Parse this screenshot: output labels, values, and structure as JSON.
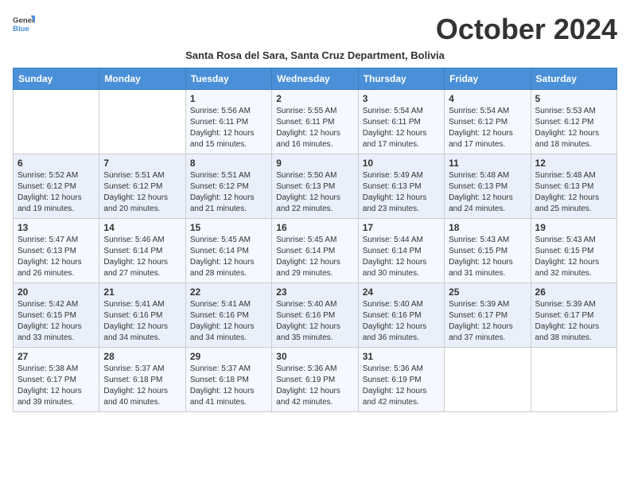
{
  "logo": {
    "text_general": "General",
    "text_blue": "Blue"
  },
  "header": {
    "month_title": "October 2024",
    "subtitle": "Santa Rosa del Sara, Santa Cruz Department, Bolivia"
  },
  "weekdays": [
    "Sunday",
    "Monday",
    "Tuesday",
    "Wednesday",
    "Thursday",
    "Friday",
    "Saturday"
  ],
  "weeks": [
    [
      {
        "day": "",
        "sunrise": "",
        "sunset": "",
        "daylight": ""
      },
      {
        "day": "",
        "sunrise": "",
        "sunset": "",
        "daylight": ""
      },
      {
        "day": "1",
        "sunrise": "Sunrise: 5:56 AM",
        "sunset": "Sunset: 6:11 PM",
        "daylight": "Daylight: 12 hours and 15 minutes."
      },
      {
        "day": "2",
        "sunrise": "Sunrise: 5:55 AM",
        "sunset": "Sunset: 6:11 PM",
        "daylight": "Daylight: 12 hours and 16 minutes."
      },
      {
        "day": "3",
        "sunrise": "Sunrise: 5:54 AM",
        "sunset": "Sunset: 6:11 PM",
        "daylight": "Daylight: 12 hours and 17 minutes."
      },
      {
        "day": "4",
        "sunrise": "Sunrise: 5:54 AM",
        "sunset": "Sunset: 6:12 PM",
        "daylight": "Daylight: 12 hours and 17 minutes."
      },
      {
        "day": "5",
        "sunrise": "Sunrise: 5:53 AM",
        "sunset": "Sunset: 6:12 PM",
        "daylight": "Daylight: 12 hours and 18 minutes."
      }
    ],
    [
      {
        "day": "6",
        "sunrise": "Sunrise: 5:52 AM",
        "sunset": "Sunset: 6:12 PM",
        "daylight": "Daylight: 12 hours and 19 minutes."
      },
      {
        "day": "7",
        "sunrise": "Sunrise: 5:51 AM",
        "sunset": "Sunset: 6:12 PM",
        "daylight": "Daylight: 12 hours and 20 minutes."
      },
      {
        "day": "8",
        "sunrise": "Sunrise: 5:51 AM",
        "sunset": "Sunset: 6:12 PM",
        "daylight": "Daylight: 12 hours and 21 minutes."
      },
      {
        "day": "9",
        "sunrise": "Sunrise: 5:50 AM",
        "sunset": "Sunset: 6:13 PM",
        "daylight": "Daylight: 12 hours and 22 minutes."
      },
      {
        "day": "10",
        "sunrise": "Sunrise: 5:49 AM",
        "sunset": "Sunset: 6:13 PM",
        "daylight": "Daylight: 12 hours and 23 minutes."
      },
      {
        "day": "11",
        "sunrise": "Sunrise: 5:48 AM",
        "sunset": "Sunset: 6:13 PM",
        "daylight": "Daylight: 12 hours and 24 minutes."
      },
      {
        "day": "12",
        "sunrise": "Sunrise: 5:48 AM",
        "sunset": "Sunset: 6:13 PM",
        "daylight": "Daylight: 12 hours and 25 minutes."
      }
    ],
    [
      {
        "day": "13",
        "sunrise": "Sunrise: 5:47 AM",
        "sunset": "Sunset: 6:13 PM",
        "daylight": "Daylight: 12 hours and 26 minutes."
      },
      {
        "day": "14",
        "sunrise": "Sunrise: 5:46 AM",
        "sunset": "Sunset: 6:14 PM",
        "daylight": "Daylight: 12 hours and 27 minutes."
      },
      {
        "day": "15",
        "sunrise": "Sunrise: 5:45 AM",
        "sunset": "Sunset: 6:14 PM",
        "daylight": "Daylight: 12 hours and 28 minutes."
      },
      {
        "day": "16",
        "sunrise": "Sunrise: 5:45 AM",
        "sunset": "Sunset: 6:14 PM",
        "daylight": "Daylight: 12 hours and 29 minutes."
      },
      {
        "day": "17",
        "sunrise": "Sunrise: 5:44 AM",
        "sunset": "Sunset: 6:14 PM",
        "daylight": "Daylight: 12 hours and 30 minutes."
      },
      {
        "day": "18",
        "sunrise": "Sunrise: 5:43 AM",
        "sunset": "Sunset: 6:15 PM",
        "daylight": "Daylight: 12 hours and 31 minutes."
      },
      {
        "day": "19",
        "sunrise": "Sunrise: 5:43 AM",
        "sunset": "Sunset: 6:15 PM",
        "daylight": "Daylight: 12 hours and 32 minutes."
      }
    ],
    [
      {
        "day": "20",
        "sunrise": "Sunrise: 5:42 AM",
        "sunset": "Sunset: 6:15 PM",
        "daylight": "Daylight: 12 hours and 33 minutes."
      },
      {
        "day": "21",
        "sunrise": "Sunrise: 5:41 AM",
        "sunset": "Sunset: 6:16 PM",
        "daylight": "Daylight: 12 hours and 34 minutes."
      },
      {
        "day": "22",
        "sunrise": "Sunrise: 5:41 AM",
        "sunset": "Sunset: 6:16 PM",
        "daylight": "Daylight: 12 hours and 34 minutes."
      },
      {
        "day": "23",
        "sunrise": "Sunrise: 5:40 AM",
        "sunset": "Sunset: 6:16 PM",
        "daylight": "Daylight: 12 hours and 35 minutes."
      },
      {
        "day": "24",
        "sunrise": "Sunrise: 5:40 AM",
        "sunset": "Sunset: 6:16 PM",
        "daylight": "Daylight: 12 hours and 36 minutes."
      },
      {
        "day": "25",
        "sunrise": "Sunrise: 5:39 AM",
        "sunset": "Sunset: 6:17 PM",
        "daylight": "Daylight: 12 hours and 37 minutes."
      },
      {
        "day": "26",
        "sunrise": "Sunrise: 5:39 AM",
        "sunset": "Sunset: 6:17 PM",
        "daylight": "Daylight: 12 hours and 38 minutes."
      }
    ],
    [
      {
        "day": "27",
        "sunrise": "Sunrise: 5:38 AM",
        "sunset": "Sunset: 6:17 PM",
        "daylight": "Daylight: 12 hours and 39 minutes."
      },
      {
        "day": "28",
        "sunrise": "Sunrise: 5:37 AM",
        "sunset": "Sunset: 6:18 PM",
        "daylight": "Daylight: 12 hours and 40 minutes."
      },
      {
        "day": "29",
        "sunrise": "Sunrise: 5:37 AM",
        "sunset": "Sunset: 6:18 PM",
        "daylight": "Daylight: 12 hours and 41 minutes."
      },
      {
        "day": "30",
        "sunrise": "Sunrise: 5:36 AM",
        "sunset": "Sunset: 6:19 PM",
        "daylight": "Daylight: 12 hours and 42 minutes."
      },
      {
        "day": "31",
        "sunrise": "Sunrise: 5:36 AM",
        "sunset": "Sunset: 6:19 PM",
        "daylight": "Daylight: 12 hours and 42 minutes."
      },
      {
        "day": "",
        "sunrise": "",
        "sunset": "",
        "daylight": ""
      },
      {
        "day": "",
        "sunrise": "",
        "sunset": "",
        "daylight": ""
      }
    ]
  ]
}
